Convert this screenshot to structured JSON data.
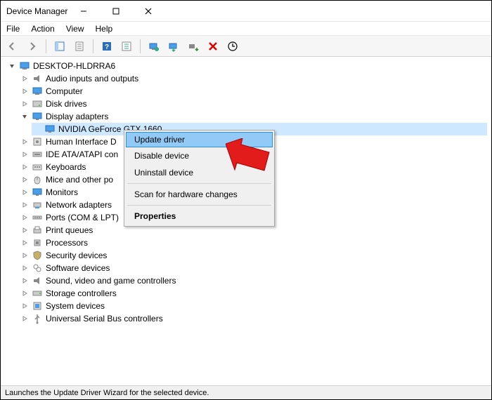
{
  "window": {
    "title": "Device Manager"
  },
  "menubar": {
    "items": [
      "File",
      "Action",
      "View",
      "Help"
    ]
  },
  "tree": {
    "root": {
      "label": "DESKTOP-HLDRRA6",
      "expanded": true
    },
    "nodes": [
      {
        "label": "Audio inputs and outputs",
        "icon": "speaker",
        "expanded": false
      },
      {
        "label": "Computer",
        "icon": "computer",
        "expanded": false
      },
      {
        "label": "Disk drives",
        "icon": "disk",
        "expanded": false
      },
      {
        "label": "Display adapters",
        "icon": "monitor",
        "expanded": true,
        "children": [
          {
            "label": "NVIDIA GeForce GTX 1660",
            "icon": "monitor",
            "selected": true
          }
        ]
      },
      {
        "label": "Human Interface D",
        "icon": "hid",
        "expanded": false
      },
      {
        "label": "IDE ATA/ATAPI con",
        "icon": "ide",
        "expanded": false
      },
      {
        "label": "Keyboards",
        "icon": "keyboard",
        "expanded": false
      },
      {
        "label": "Mice and other po",
        "icon": "mouse",
        "expanded": false
      },
      {
        "label": "Monitors",
        "icon": "monitor",
        "expanded": false
      },
      {
        "label": "Network adapters",
        "icon": "network",
        "expanded": false
      },
      {
        "label": "Ports (COM & LPT)",
        "icon": "port",
        "expanded": false
      },
      {
        "label": "Print queues",
        "icon": "printer",
        "expanded": false
      },
      {
        "label": "Processors",
        "icon": "cpu",
        "expanded": false
      },
      {
        "label": "Security devices",
        "icon": "security",
        "expanded": false
      },
      {
        "label": "Software devices",
        "icon": "software",
        "expanded": false
      },
      {
        "label": "Sound, video and game controllers",
        "icon": "speaker",
        "expanded": false
      },
      {
        "label": "Storage controllers",
        "icon": "storage",
        "expanded": false
      },
      {
        "label": "System devices",
        "icon": "system",
        "expanded": false
      },
      {
        "label": "Universal Serial Bus controllers",
        "icon": "usb",
        "expanded": false
      }
    ]
  },
  "context_menu": {
    "items": [
      {
        "label": "Update driver",
        "highlight": true
      },
      {
        "label": "Disable device"
      },
      {
        "label": "Uninstall device"
      },
      {
        "separator": true
      },
      {
        "label": "Scan for hardware changes"
      },
      {
        "separator": true
      },
      {
        "label": "Properties",
        "bold": true
      }
    ]
  },
  "statusbar": {
    "text": "Launches the Update Driver Wizard for the selected device."
  }
}
